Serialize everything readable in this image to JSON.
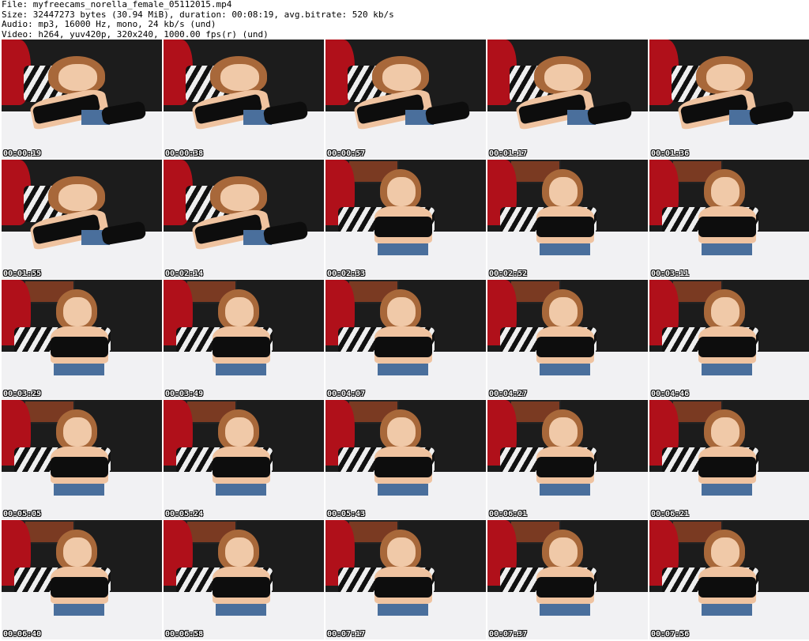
{
  "header": {
    "file": "File: myfreecams_norella_female_05112015.mp4",
    "size": "Size: 32447273 bytes (30.94 MiB), duration: 00:08:19, avg.bitrate: 520 kb/s",
    "audio": "Audio: mp3, 16000 Hz, mono, 24 kb/s (und)",
    "video": "Video: h264, yuv420p, 320x240, 1000.00 fps(r) (und)"
  },
  "thumbnails": [
    {
      "time": "00:00:19",
      "pose": "lying"
    },
    {
      "time": "00:00:38",
      "pose": "lying"
    },
    {
      "time": "00:00:57",
      "pose": "lying"
    },
    {
      "time": "00:01:17",
      "pose": "lying"
    },
    {
      "time": "00:01:36",
      "pose": "lying"
    },
    {
      "time": "00:01:55",
      "pose": "lying"
    },
    {
      "time": "00:02:14",
      "pose": "lying"
    },
    {
      "time": "00:02:33",
      "pose": "upright"
    },
    {
      "time": "00:02:52",
      "pose": "upright"
    },
    {
      "time": "00:03:11",
      "pose": "upright"
    },
    {
      "time": "00:03:29",
      "pose": "upright"
    },
    {
      "time": "00:03:49",
      "pose": "upright"
    },
    {
      "time": "00:04:07",
      "pose": "upright"
    },
    {
      "time": "00:04:27",
      "pose": "upright"
    },
    {
      "time": "00:04:46",
      "pose": "upright"
    },
    {
      "time": "00:05:05",
      "pose": "upright"
    },
    {
      "time": "00:05:24",
      "pose": "upright"
    },
    {
      "time": "00:05:43",
      "pose": "upright"
    },
    {
      "time": "00:06:01",
      "pose": "upright"
    },
    {
      "time": "00:06:21",
      "pose": "upright"
    },
    {
      "time": "00:06:40",
      "pose": "upright"
    },
    {
      "time": "00:06:58",
      "pose": "upright"
    },
    {
      "time": "00:07:17",
      "pose": "upright"
    },
    {
      "time": "00:07:37",
      "pose": "upright"
    },
    {
      "time": "00:07:56",
      "pose": "upright"
    }
  ],
  "colors": {
    "timestamp_text": "#ffffff",
    "timestamp_outline": "#000000",
    "background": "#ffffff"
  }
}
